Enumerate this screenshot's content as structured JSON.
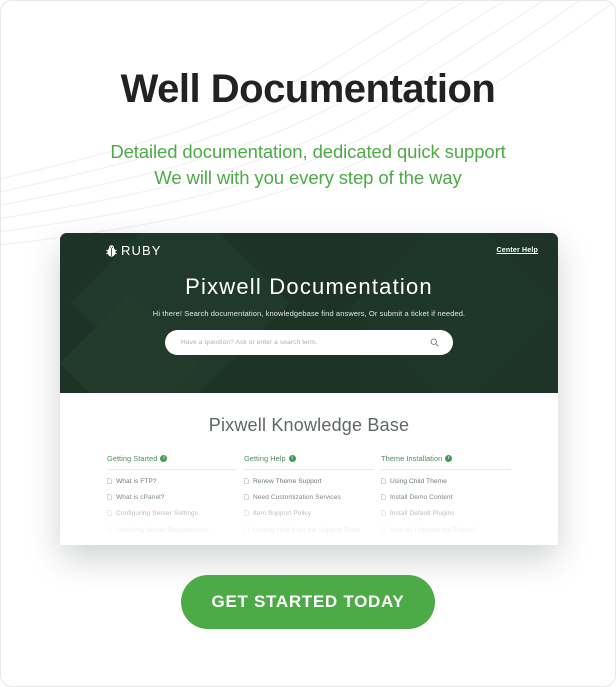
{
  "hero": {
    "title": "Well Documentation",
    "subtitle_line1": "Detailed documentation, dedicated quick support",
    "subtitle_line2": "We will with you every step of the way"
  },
  "mockup": {
    "brand": {
      "name": "RUBY",
      "logo_icon": "ruby-bug-logo-icon"
    },
    "nav": {
      "center_help": "Center Help"
    },
    "hero": {
      "title": "Pixwell Documentation",
      "lead": "Hi there! Search documentation, knowledgebase find answers, Or submit a ticket if needed.",
      "search_placeholder": "Have a question? Ask or enter a search term.",
      "search_value": "",
      "search_icon": "search-icon"
    },
    "knowledge_base": {
      "title": "Pixwell Knowledge Base",
      "badge_glyph": "!",
      "columns": [
        {
          "title": "Getting Started",
          "items": [
            "What is FTP?",
            "What is cPanel?",
            "Configuring Server Settings",
            "Checking Server Requirements"
          ]
        },
        {
          "title": "Getting Help",
          "items": [
            "Renew Theme Support",
            "Need Customization Services",
            "Item Support Policy",
            "Getting Help from the Support Team"
          ]
        },
        {
          "title": "Theme Installation",
          "items": [
            "Using Child Theme",
            "Install Demo Content",
            "Install Default Plugins",
            "How do I Update the Theme?"
          ]
        }
      ]
    }
  },
  "cta": {
    "label": "GET STARTED TODAY"
  },
  "colors": {
    "accent_green": "#4cab46",
    "hero_dark": "#1d3328",
    "title_dark": "#222222",
    "kb_heading_green": "#4f8f5a",
    "badge_green": "#3f9e54",
    "body_gray": "#6d7a76"
  }
}
